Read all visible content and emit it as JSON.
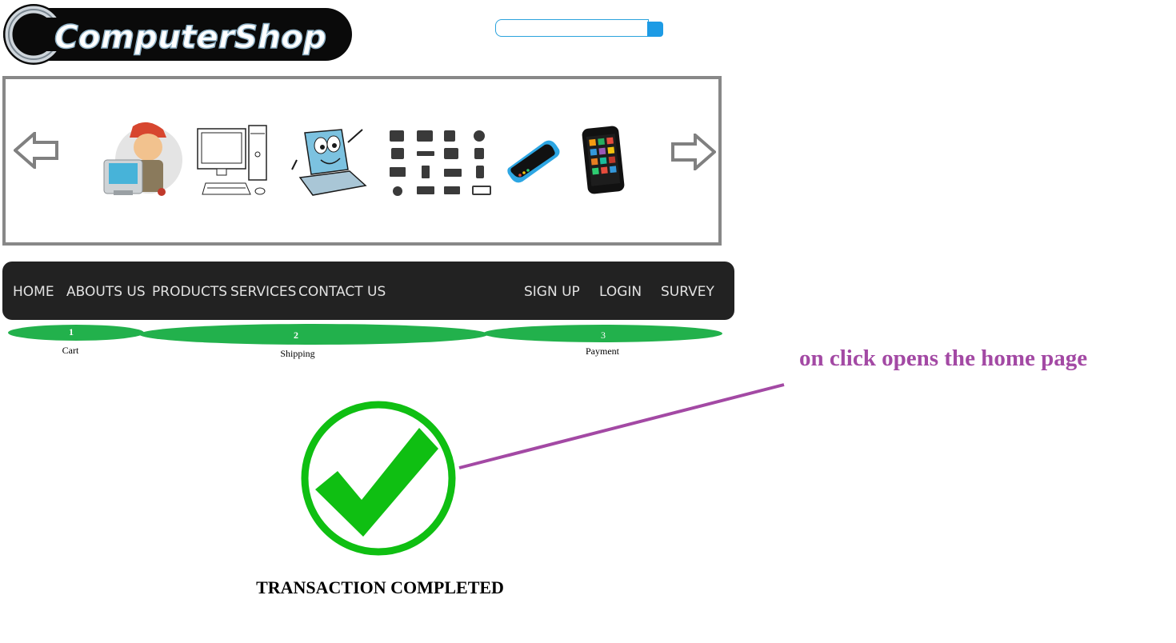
{
  "brand": {
    "logo_text": "ComputerShop"
  },
  "search": {
    "placeholder": "",
    "value": ""
  },
  "carousel": {
    "images": [
      "technician-icon",
      "desktop-computer-icon",
      "laptop-cartoon-icon",
      "hardware-grid-icon",
      "smartphone-icon",
      "tablet-icon"
    ]
  },
  "nav": {
    "left_items": [
      "HOME",
      "ABOUTS US",
      "PRODUCTS",
      "SERVICES",
      "CONTACT US"
    ],
    "right_items": [
      "SIGN UP",
      "LOGIN",
      "SURVEY"
    ]
  },
  "checkout_steps": [
    {
      "number": "1",
      "label": "Cart"
    },
    {
      "number": "2",
      "label": "Shipping"
    },
    {
      "number": "3",
      "label": "Payment"
    }
  ],
  "status": {
    "message": "TRANSACTION COMPLETED"
  },
  "annotation": {
    "text": "on click opens the home page"
  },
  "colors": {
    "nav_bg": "#222222",
    "step_green": "#22b14c",
    "check_green": "#0fbf12",
    "annotation_purple": "#a349a4",
    "search_accent": "#1d9be5"
  }
}
